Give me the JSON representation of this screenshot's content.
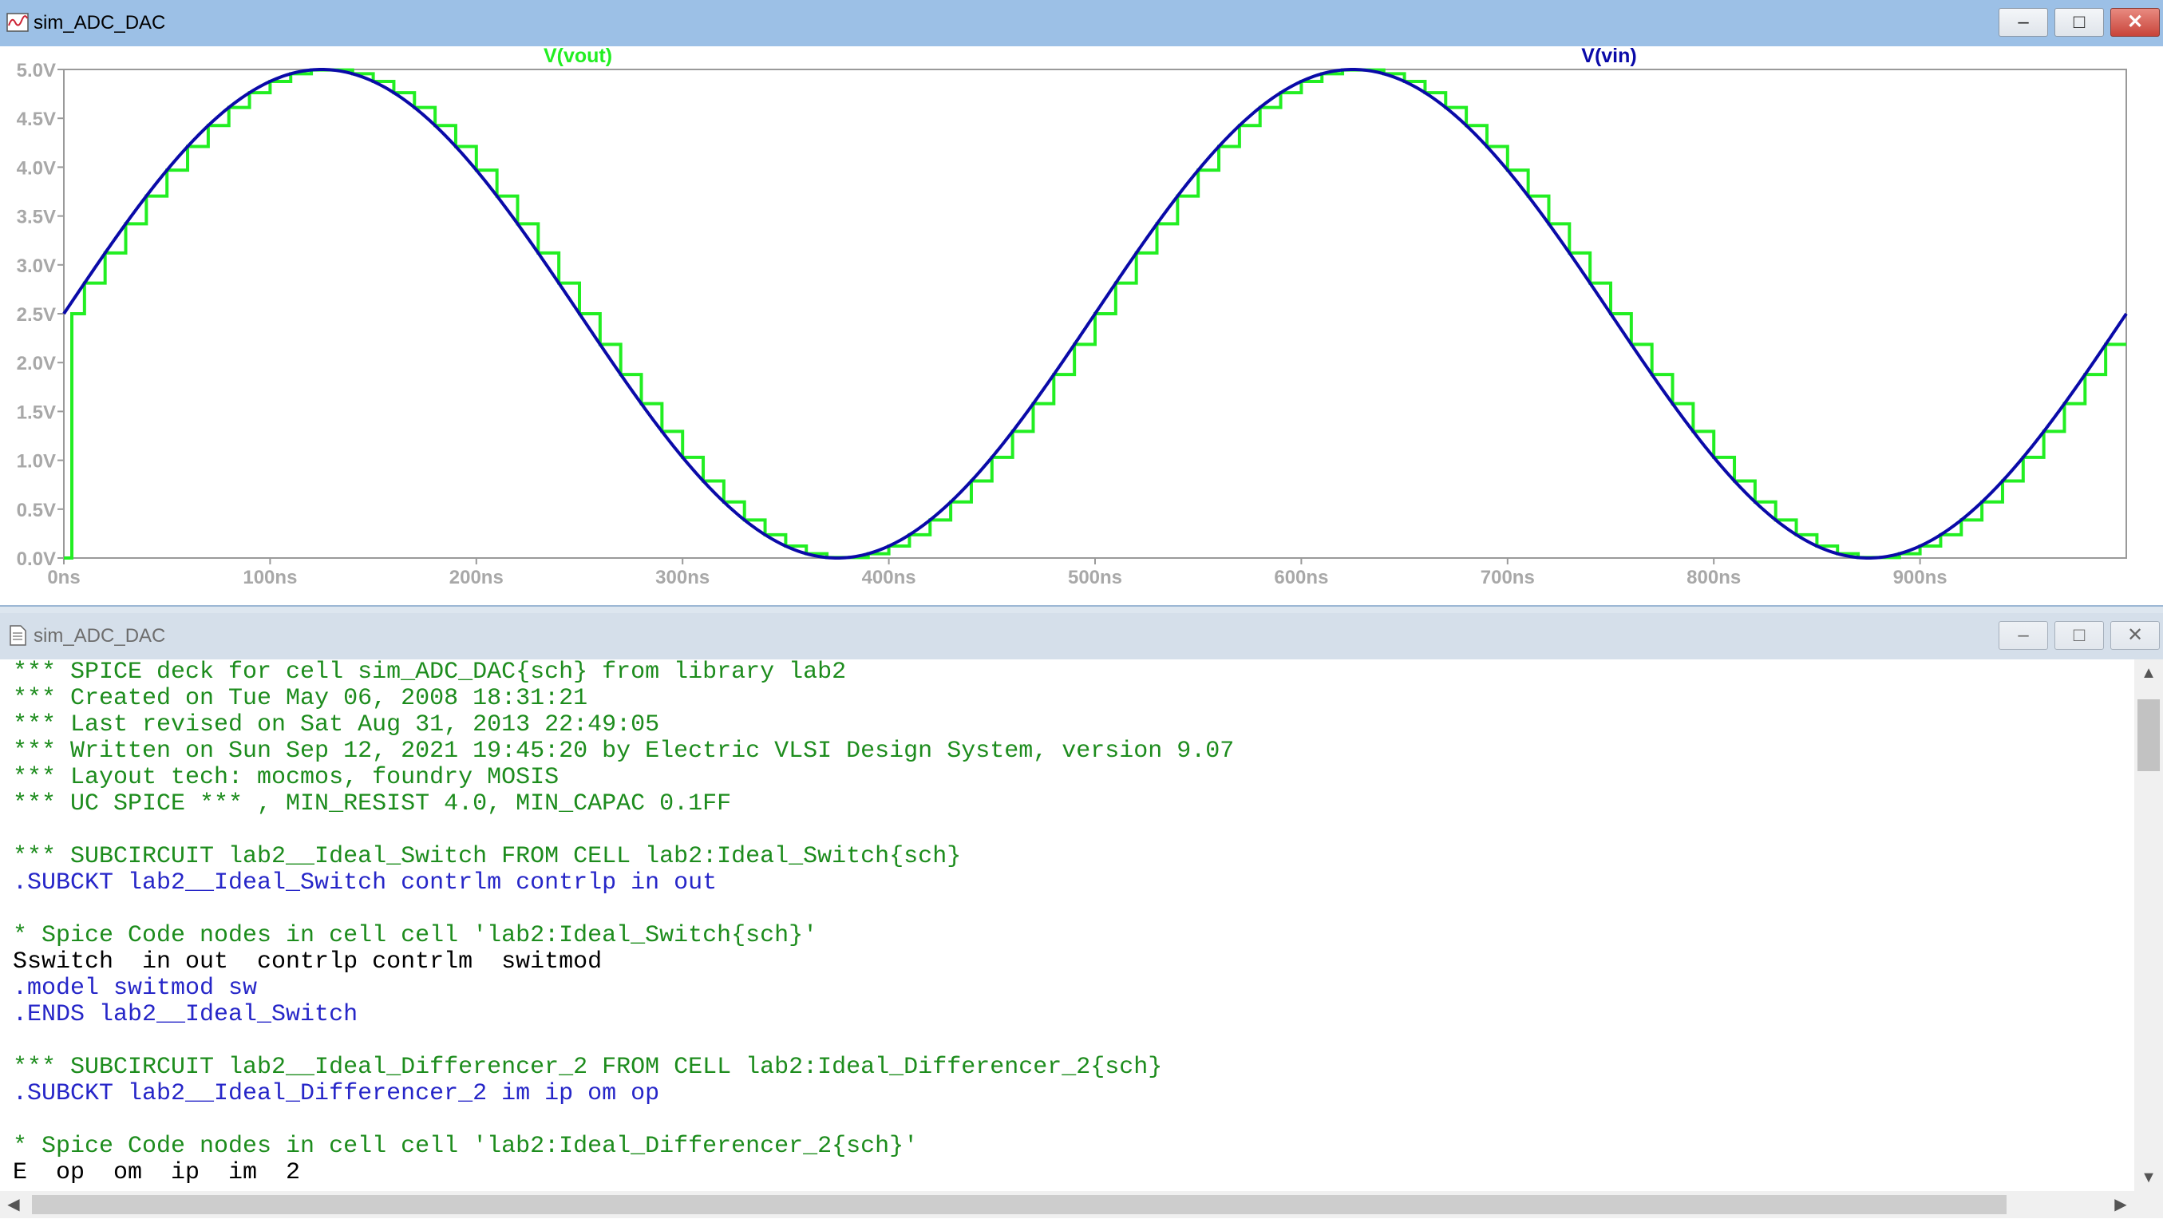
{
  "plot_window": {
    "title": "sim_ADC_DAC",
    "icon": "waveform-icon",
    "buttons": {
      "minimize": "–",
      "maximize": "□",
      "close": "✕"
    }
  },
  "chart_data": {
    "type": "line",
    "x_unit": "ns",
    "xlim": [
      0,
      1000
    ],
    "ylim": [
      0,
      5
    ],
    "x_ticks": [
      "0ns",
      "100ns",
      "200ns",
      "300ns",
      "400ns",
      "500ns",
      "600ns",
      "700ns",
      "800ns",
      "900ns"
    ],
    "y_ticks": [
      "0.0V",
      "0.5V",
      "1.0V",
      "1.5V",
      "2.0V",
      "2.5V",
      "3.0V",
      "3.5V",
      "4.0V",
      "4.5V",
      "5.0V"
    ],
    "grid": false,
    "series": [
      {
        "name": "V(vout)",
        "color": "#22ee22",
        "style": "step",
        "sample_period_ns": 10,
        "offset_v": 2.5,
        "amplitude_v": 2.5,
        "period_ns": 500,
        "starts_at_v": 0.0
      },
      {
        "name": "V(vin)",
        "color": "#0a0aa8",
        "style": "sine",
        "offset_v": 2.5,
        "amplitude_v": 2.5,
        "period_ns": 500,
        "phase_deg": 0
      }
    ]
  },
  "text_window": {
    "title": "sim_ADC_DAC",
    "icon": "document-icon",
    "buttons": {
      "minimize": "–",
      "maximize": "□",
      "close": "✕"
    },
    "lines": [
      {
        "text": "*** SPICE deck for cell sim_ADC_DAC{sch} from library lab2",
        "kind": "comment"
      },
      {
        "text": "*** Created on Tue May 06, 2008 18:31:21",
        "kind": "comment"
      },
      {
        "text": "*** Last revised on Sat Aug 31, 2013 22:49:05",
        "kind": "comment"
      },
      {
        "text": "*** Written on Sun Sep 12, 2021 19:45:20 by Electric VLSI Design System, version 9.07",
        "kind": "comment"
      },
      {
        "text": "*** Layout tech: mocmos, foundry MOSIS",
        "kind": "comment"
      },
      {
        "text": "*** UC SPICE *** , MIN_RESIST 4.0, MIN_CAPAC 0.1FF",
        "kind": "comment"
      },
      {
        "text": "",
        "kind": "plain"
      },
      {
        "text": "*** SUBCIRCUIT lab2__Ideal_Switch FROM CELL lab2:Ideal_Switch{sch}",
        "kind": "comment"
      },
      {
        "text": ".SUBCKT lab2__Ideal_Switch contrlm contrlp in out",
        "kind": "cmd"
      },
      {
        "text": "",
        "kind": "plain"
      },
      {
        "text": "* Spice Code nodes in cell cell 'lab2:Ideal_Switch{sch}'",
        "kind": "comment"
      },
      {
        "text": "Sswitch  in out  contrlp contrlm  switmod",
        "kind": "plain"
      },
      {
        "text": ".model switmod sw",
        "kind": "cmd"
      },
      {
        "text": ".ENDS lab2__Ideal_Switch",
        "kind": "cmd"
      },
      {
        "text": "",
        "kind": "plain"
      },
      {
        "text": "*** SUBCIRCUIT lab2__Ideal_Differencer_2 FROM CELL lab2:Ideal_Differencer_2{sch}",
        "kind": "comment"
      },
      {
        "text": ".SUBCKT lab2__Ideal_Differencer_2 im ip om op",
        "kind": "cmd"
      },
      {
        "text": "",
        "kind": "plain"
      },
      {
        "text": "* Spice Code nodes in cell cell 'lab2:Ideal_Differencer_2{sch}'",
        "kind": "comment"
      },
      {
        "text": "E  op  om  ip  im  2",
        "kind": "plain"
      }
    ]
  },
  "scrollbars": {
    "up": "▲",
    "down": "▼",
    "left": "◀",
    "right": "▶"
  }
}
